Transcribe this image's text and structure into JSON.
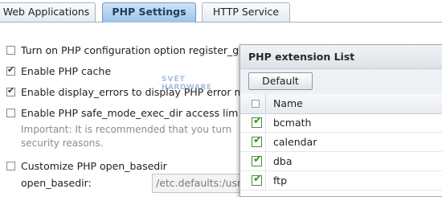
{
  "tabs": [
    {
      "label": "Web Applications",
      "active": false
    },
    {
      "label": "PHP Settings",
      "active": true
    },
    {
      "label": "HTTP Service",
      "active": false
    }
  ],
  "options": [
    {
      "label": "Turn on PHP configuration option register_g",
      "checked": false
    },
    {
      "label": "Enable PHP cache",
      "checked": true
    },
    {
      "label": "Enable display_errors to display PHP error m",
      "checked": true
    },
    {
      "label": "Enable PHP safe_mode_exec_dir access lim",
      "checked": false
    },
    {
      "label": "Customize PHP open_basedir",
      "checked": false
    }
  ],
  "note": "Important: It is recommended that you turn security reasons.",
  "open_basedir": {
    "label": "open_basedir:",
    "value": "/etc.defaults:/usr"
  },
  "watermark": {
    "line1": "SVĚT",
    "line2": "HARDWARE"
  },
  "popup": {
    "title": "PHP extension List",
    "default_button": "Default",
    "column_name": "Name",
    "extensions": [
      {
        "name": "bcmath",
        "checked": true
      },
      {
        "name": "calendar",
        "checked": true
      },
      {
        "name": "dba",
        "checked": true
      },
      {
        "name": "ftp",
        "checked": true
      }
    ]
  },
  "colors": {
    "active_tab": "#9cc3e6",
    "check_green": "#2f9a1e",
    "note_gray": "#8c8c8c"
  }
}
